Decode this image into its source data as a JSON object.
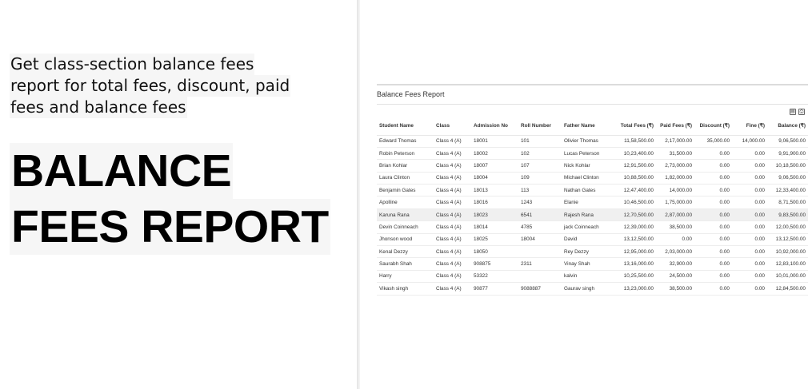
{
  "intro": {
    "subtitle_lines": [
      "Get class-section balance fees",
      "report for total fees, discount, paid",
      "fees and balance fees"
    ],
    "headline_lines": [
      "BALANCE",
      "FEES REPORT"
    ]
  },
  "report": {
    "title": "Balance Fees Report",
    "export_icons": [
      "export-excel-icon",
      "print-icon"
    ],
    "columns": {
      "student_name": "Student Name",
      "class": "Class",
      "admission_no": "Admission No",
      "roll_number": "Roll Number",
      "father_name": "Father Name",
      "total_fees": "Total Fees (₹)",
      "paid_fees": "Paid Fees (₹)",
      "discount": "Discount (₹)",
      "fine": "Fine (₹)",
      "balance": "Balance (₹)"
    },
    "rows": [
      [
        "Edward Thomas",
        "Class 4 (A)",
        "18001",
        "101",
        "Olivier Thomas",
        "11,58,500.00",
        "2,17,000.00",
        "35,000.00",
        "14,000.00",
        "9,06,500.00"
      ],
      [
        "Robin Peterson",
        "Class 4 (A)",
        "18002",
        "102",
        "Lucas Peterson",
        "10,23,400.00",
        "31,500.00",
        "0.00",
        "0.00",
        "9,91,900.00"
      ],
      [
        "Brian Kohlar",
        "Class 4 (A)",
        "18007",
        "107",
        "Nick Kohlar",
        "12,91,500.00",
        "2,73,000.00",
        "0.00",
        "0.00",
        "10,18,500.00"
      ],
      [
        "Laura Clinton",
        "Class 4 (A)",
        "18004",
        "109",
        "Michael Clinton",
        "10,88,500.00",
        "1,82,000.00",
        "0.00",
        "0.00",
        "9,06,500.00"
      ],
      [
        "Benjamin Gates",
        "Class 4 (A)",
        "18013",
        "113",
        "Nathan Gates",
        "12,47,400.00",
        "14,000.00",
        "0.00",
        "0.00",
        "12,33,400.00"
      ],
      [
        "Apolline",
        "Class 4 (A)",
        "18016",
        "1243",
        "Elanie",
        "10,46,500.00",
        "1,75,000.00",
        "0.00",
        "0.00",
        "8,71,500.00"
      ],
      [
        "Karuna Rana",
        "Class 4 (A)",
        "18023",
        "6541",
        "Rajesh Rana",
        "12,70,500.00",
        "2,87,000.00",
        "0.00",
        "0.00",
        "9,83,500.00"
      ],
      [
        "Devin Coinneach",
        "Class 4 (A)",
        "18014",
        "4785",
        "jack Coinneach",
        "12,39,000.00",
        "38,500.00",
        "0.00",
        "0.00",
        "12,00,500.00"
      ],
      [
        "Jhonson wood",
        "Class 4 (A)",
        "18025",
        "18004",
        "David",
        "13,12,500.00",
        "0.00",
        "0.00",
        "0.00",
        "13,12,500.00"
      ],
      [
        "Kenal Dezzy",
        "Class 4 (A)",
        "18050",
        "",
        "Rey Dezzy",
        "12,95,000.00",
        "2,03,000.00",
        "0.00",
        "0.00",
        "10,92,000.00"
      ],
      [
        "Saurabh Shah",
        "Class 4 (A)",
        "908875",
        "2311",
        "Vinay Shah",
        "13,16,000.00",
        "32,900.00",
        "0.00",
        "0.00",
        "12,83,100.00"
      ],
      [
        "Harry",
        "Class 4 (A)",
        "53322",
        "",
        "kalvin",
        "10,25,500.00",
        "24,500.00",
        "0.00",
        "0.00",
        "10,01,000.00"
      ],
      [
        "Vikash singh",
        "Class 4 (A)",
        "90877",
        "9088887",
        "Gaurav singh",
        "13,23,000.00",
        "38,500.00",
        "0.00",
        "0.00",
        "12,84,500.00"
      ]
    ],
    "highlighted_row": 6
  }
}
